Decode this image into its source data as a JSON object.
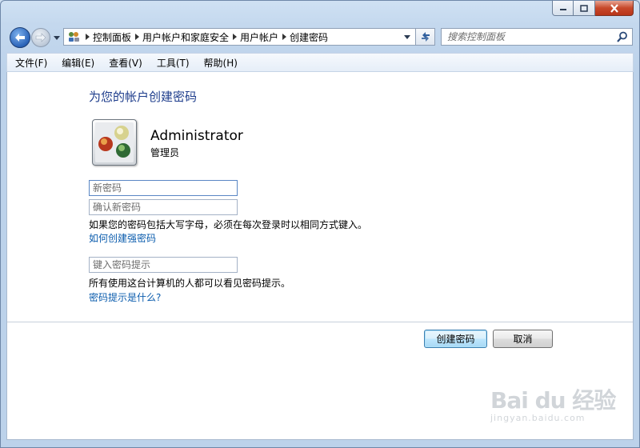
{
  "window": {
    "controls": {
      "minimize": "minimize",
      "maximize": "maximize",
      "close": "close"
    }
  },
  "navigation": {
    "breadcrumbs": [
      "控制面板",
      "用户帐户和家庭安全",
      "用户帐户",
      "创建密码"
    ],
    "search_placeholder": "搜索控制面板"
  },
  "menu": [
    "文件(F)",
    "编辑(E)",
    "查看(V)",
    "工具(T)",
    "帮助(H)"
  ],
  "page": {
    "heading": "为您的帐户创建密码",
    "user": {
      "name": "Administrator",
      "role": "管理员"
    },
    "new_password_placeholder": "新密码",
    "confirm_password_placeholder": "确认新密码",
    "caps_note": "如果您的密码包括大写字母，必须在每次登录时以相同方式键入。",
    "strong_password_link": "如何创建强密码",
    "hint_placeholder": "键入密码提示",
    "hint_note": "所有使用这台计算机的人都可以看见密码提示。",
    "hint_link": "密码提示是什么?",
    "create_button": "创建密码",
    "cancel_button": "取消"
  },
  "watermark": {
    "logo": "Bai du 经验",
    "url": "jingyan.baidu.com"
  },
  "colors": {
    "heading": "#1e3d8c",
    "link": "#0b5cad",
    "close_button": "#c7482a"
  }
}
